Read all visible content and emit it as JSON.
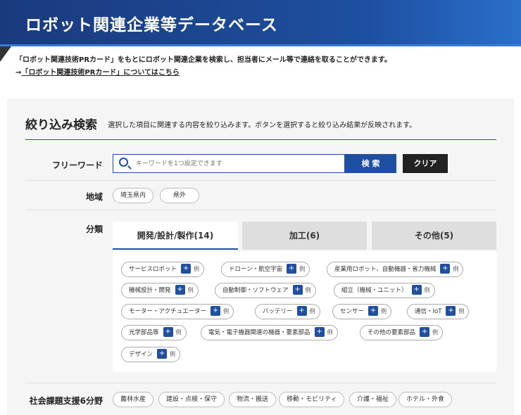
{
  "banner": {
    "title": "ロボット関連企業等データベース"
  },
  "intro": {
    "line1": "「ロボット関連技術PRカード」をもとにロボット関連企業を検索し、担当者にメール等で連絡を取ることができます。",
    "prefix": "→",
    "link": "「ロボット関連技術PRカード」についてはこちら"
  },
  "filter": {
    "title": "絞り込み検索",
    "description": "選択した項目に関連する内容を絞り込みます。ボタンを選択すると絞り込み結果が反映されます。"
  },
  "freeword": {
    "label": "フリーワード",
    "placeholder": "キーワードを1つ設定できます",
    "search_label": "検 索",
    "clear_label": "クリア"
  },
  "region": {
    "label": "地域",
    "options": [
      "埼玉県内",
      "県外"
    ]
  },
  "category": {
    "label": "分類",
    "tabs": [
      {
        "label": "開発/設計/製作(14)"
      },
      {
        "label": "加工(6)"
      },
      {
        "label": "その他(5)"
      }
    ],
    "plus": "+",
    "example": "例",
    "items": [
      "サービスロボット",
      "ドローン・航空宇宙",
      "産業用ロボット、自動機器・省力機械",
      "機械設計・開発",
      "自動制御・ソフトウェア",
      "組立（機械・ユニット）",
      "モーター・アクチュエーター",
      "バッテリー",
      "センサー",
      "通信・IoT",
      "光学部品等",
      "電気・電子機器関連の機器・要素部品",
      "その他の要素部品",
      "デザイン"
    ]
  },
  "social": {
    "label": "社会課題支援6分野",
    "options": [
      "農林水産",
      "建設・点検・保守",
      "物流・搬送",
      "移動・モビリティ",
      "介護・福祉",
      "ホテル・外食"
    ]
  }
}
